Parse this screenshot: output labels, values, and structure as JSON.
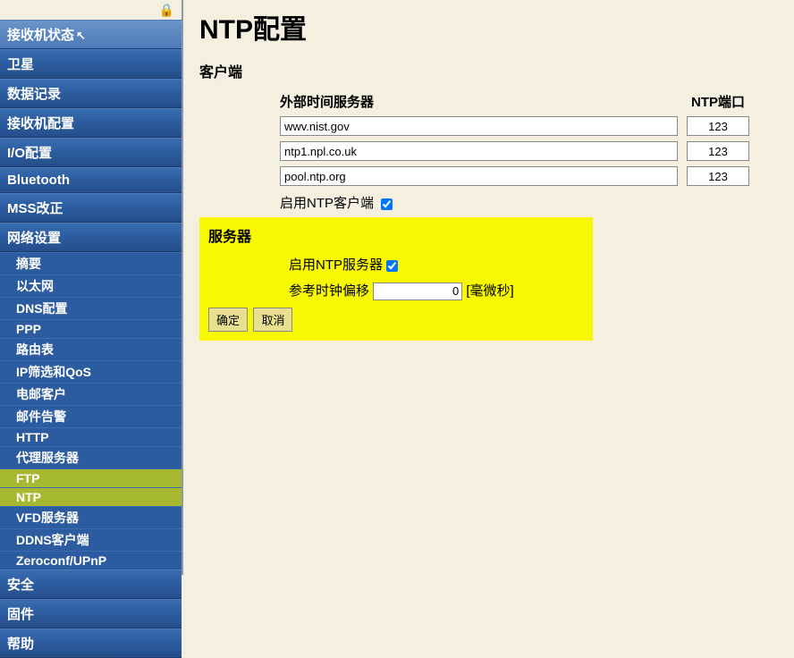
{
  "sidebar": {
    "items": [
      {
        "label": "接收机状态",
        "hover": true
      },
      {
        "label": "卫星"
      },
      {
        "label": "数据记录"
      },
      {
        "label": "接收机配置"
      },
      {
        "label": "I/O配置"
      },
      {
        "label": "Bluetooth"
      },
      {
        "label": "MSS改正"
      },
      {
        "label": "网络设置",
        "expanded": true,
        "subs": [
          {
            "label": "摘要"
          },
          {
            "label": "以太网"
          },
          {
            "label": "DNS配置"
          },
          {
            "label": "PPP"
          },
          {
            "label": "路由表"
          },
          {
            "label": "IP筛选和QoS"
          },
          {
            "label": "电邮客户"
          },
          {
            "label": "邮件告警"
          },
          {
            "label": "HTTP"
          },
          {
            "label": "代理服务器"
          },
          {
            "label": "FTP",
            "active": true
          },
          {
            "label": "NTP",
            "active": true
          },
          {
            "label": "VFD服务器"
          },
          {
            "label": "DDNS客户端"
          },
          {
            "label": "Zeroconf/UPnP"
          }
        ]
      },
      {
        "label": "安全"
      },
      {
        "label": "固件"
      },
      {
        "label": "帮助"
      }
    ]
  },
  "page": {
    "title": "NTP配置",
    "client_section": "客户端",
    "header_server": "外部时间服务器",
    "header_port": "NTP端口",
    "servers": [
      {
        "host": "wwv.nist.gov",
        "port": "123"
      },
      {
        "host": "ntp1.npl.co.uk",
        "port": "123"
      },
      {
        "host": "pool.ntp.org",
        "port": "123"
      }
    ],
    "enable_client_label": "启用NTP客户端",
    "server_section": "服务器",
    "enable_server_label": "启用NTP服务器",
    "offset_label": "参考时钟偏移",
    "offset_value": "0",
    "offset_unit": "[毫微秒]",
    "btn_ok": "确定",
    "btn_cancel": "取消"
  }
}
